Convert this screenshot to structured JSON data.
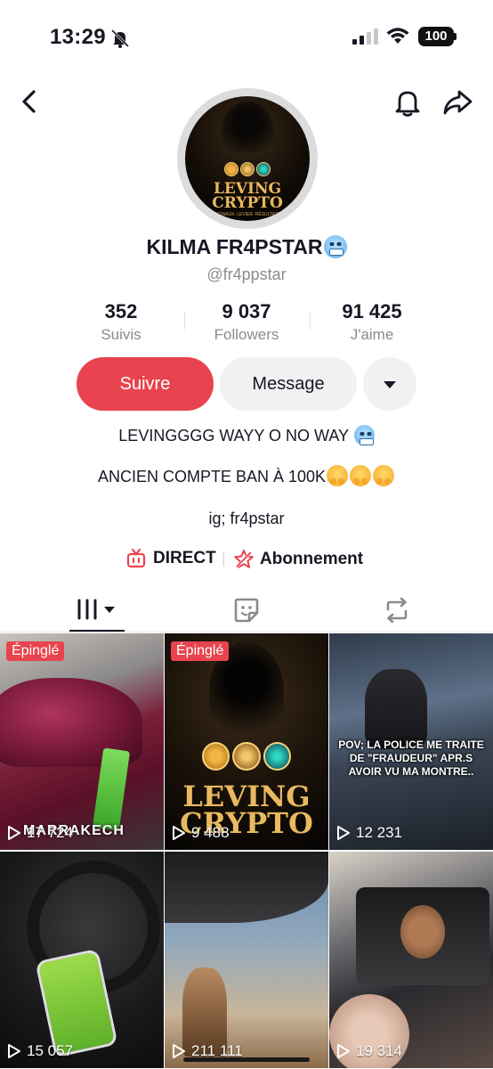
{
  "status_bar": {
    "time": "13:29",
    "battery": "100"
  },
  "nav": {
    "back_icon": "chevron-left-icon",
    "notification_icon": "bell-icon",
    "share_icon": "share-arrow-icon"
  },
  "avatar": {
    "title_line1": "LEVING",
    "title_line2": "CRYPTO",
    "subtitle": "SIGNAUX. LEVIER. RÉSULTATS"
  },
  "profile": {
    "name": "KILMA FR4PSTAR",
    "handle": "@fr4ppstar"
  },
  "stats": [
    {
      "value": "352",
      "label": "Suivis"
    },
    {
      "value": "9 037",
      "label": "Followers"
    },
    {
      "value": "91 425",
      "label": "J'aime"
    }
  ],
  "actions": {
    "follow_label": "Suivre",
    "message_label": "Message",
    "follow_color": "#e8434e"
  },
  "bio": {
    "line1": "LEVINGGGG WAYY O NO WAY",
    "line2": "ANCIEN COMPTE BAN À 100K",
    "line3": "ig; fr4pstar"
  },
  "links": {
    "live_label": "DIRECT",
    "subscription_label": "Abonnement"
  },
  "tabs": [
    {
      "icon": "grid-videos-icon"
    },
    {
      "icon": "sticker-favorites-icon"
    },
    {
      "icon": "repost-icon"
    }
  ],
  "videos": [
    {
      "pinned_label": "Épinglé",
      "views": "17 724",
      "caption": "MARRAKECH"
    },
    {
      "pinned_label": "Épinglé",
      "views": "9 488",
      "caption": ""
    },
    {
      "views": "12 231",
      "overlay_text": "POV; LA POLICE ME TRAITE DE \"FRAUDEUR\" APR.S AVOIR VU MA MONTRE.."
    },
    {
      "views": "15 057"
    },
    {
      "views": "211 111"
    },
    {
      "views": "19 314"
    }
  ]
}
